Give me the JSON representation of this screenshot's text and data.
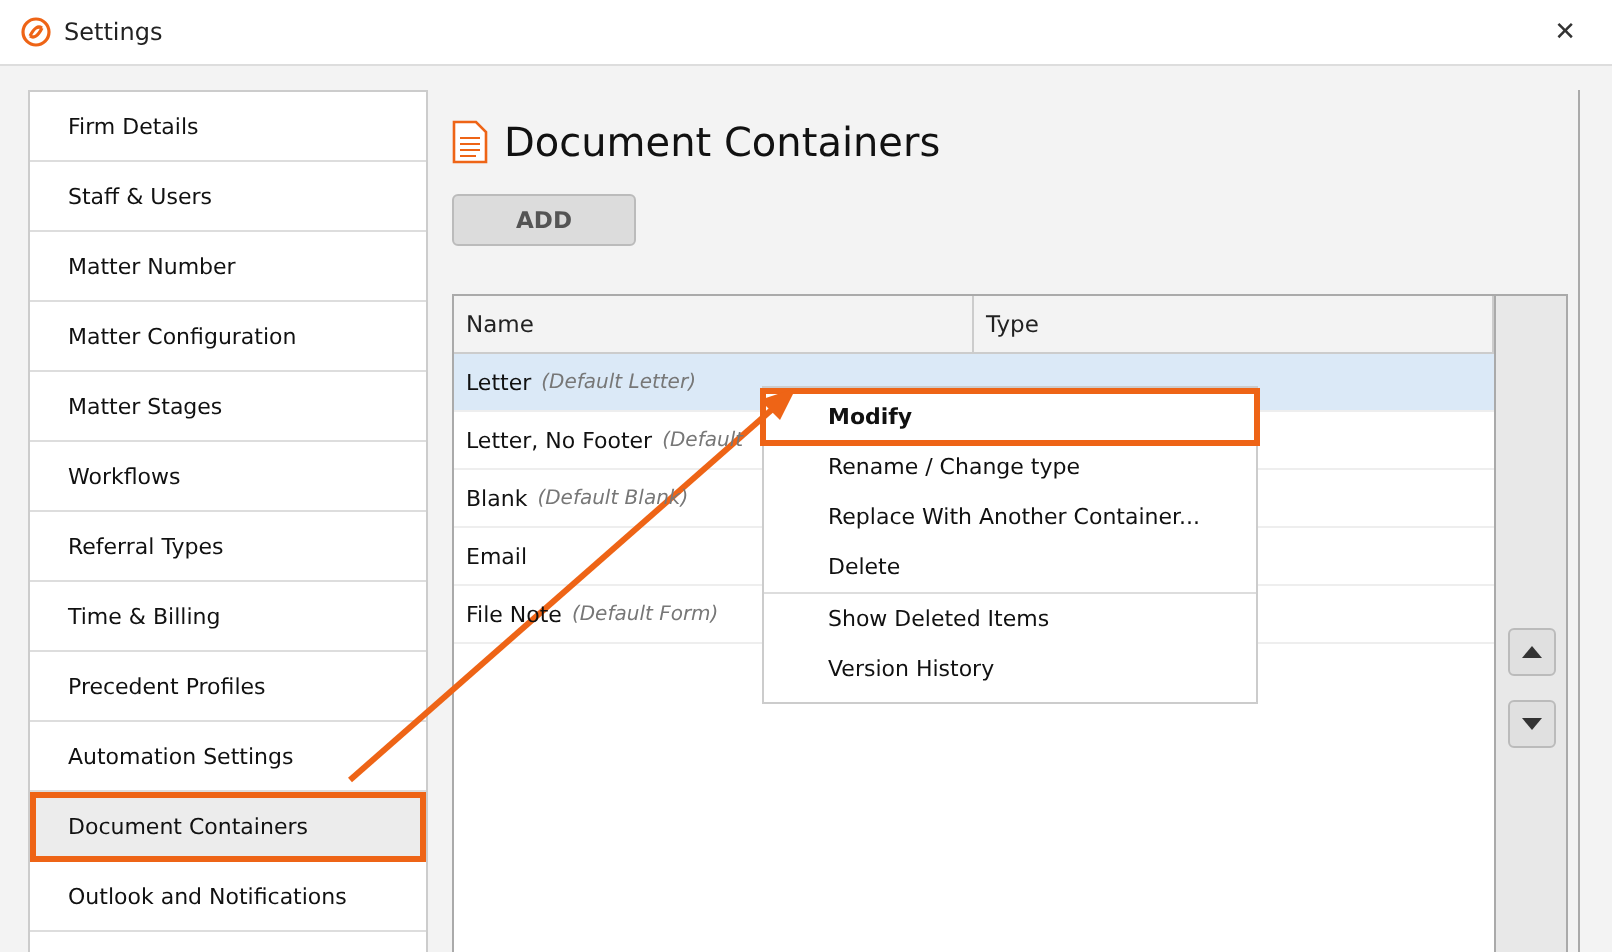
{
  "window": {
    "title": "Settings",
    "close": "✕"
  },
  "sidebar": {
    "items": [
      {
        "label": "Firm Details",
        "selected": false,
        "highlighted": false
      },
      {
        "label": "Staff & Users",
        "selected": false,
        "highlighted": false
      },
      {
        "label": "Matter Number",
        "selected": false,
        "highlighted": false
      },
      {
        "label": "Matter Configuration",
        "selected": false,
        "highlighted": false
      },
      {
        "label": "Matter Stages",
        "selected": false,
        "highlighted": false
      },
      {
        "label": "Workflows",
        "selected": false,
        "highlighted": false
      },
      {
        "label": "Referral Types",
        "selected": false,
        "highlighted": false
      },
      {
        "label": "Time & Billing",
        "selected": false,
        "highlighted": false
      },
      {
        "label": "Precedent Profiles",
        "selected": false,
        "highlighted": false
      },
      {
        "label": "Automation Settings",
        "selected": false,
        "highlighted": false
      },
      {
        "label": "Document Containers",
        "selected": true,
        "highlighted": true
      },
      {
        "label": "Outlook and Notifications",
        "selected": false,
        "highlighted": false
      }
    ]
  },
  "page": {
    "title": "Document Containers",
    "add_button": "ADD"
  },
  "table": {
    "columns": [
      "Name",
      "Type"
    ],
    "rows": [
      {
        "name": "Letter",
        "note": "(Default Letter)",
        "selected": true
      },
      {
        "name": "Letter, No Footer",
        "note": "(Default",
        "selected": false
      },
      {
        "name": "Blank",
        "note": "(Default Blank)",
        "selected": false
      },
      {
        "name": "Email",
        "selected": false
      },
      {
        "name": "File Note",
        "note": "(Default Form)",
        "selected": false
      }
    ]
  },
  "context_menu": {
    "items": [
      {
        "label": "Modify",
        "bold": true,
        "highlighted": true,
        "separator_before": false
      },
      {
        "label": "Rename / Change type",
        "bold": false,
        "highlighted": false,
        "separator_before": false
      },
      {
        "label": "Replace With Another Container...",
        "bold": false,
        "highlighted": false,
        "separator_before": false
      },
      {
        "label": "Delete",
        "bold": false,
        "highlighted": false,
        "separator_before": false
      },
      {
        "label": "Show Deleted Items",
        "bold": false,
        "highlighted": false,
        "separator_before": true
      },
      {
        "label": "Version History",
        "bold": false,
        "highlighted": false,
        "separator_before": false
      }
    ]
  }
}
